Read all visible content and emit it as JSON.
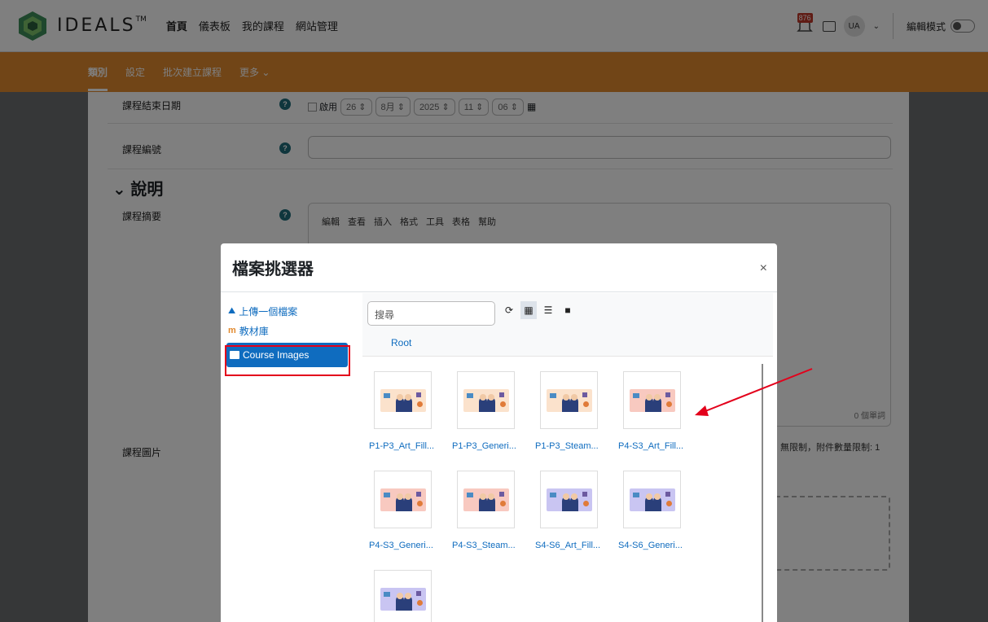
{
  "topbar": {
    "brand": "IDEALS",
    "brand_tm": "TM",
    "nav": [
      "首頁",
      "儀表板",
      "我的課程",
      "網站管理"
    ],
    "notification_count": "876",
    "user_initials": "UA",
    "edit_mode_label": "編輯模式"
  },
  "subnav": {
    "items": [
      "類別",
      "設定",
      "批次建立課程",
      "更多"
    ]
  },
  "form": {
    "end_date_label": "課程結束日期",
    "enable_label": "啟用",
    "date": {
      "day": "26",
      "month": "8月",
      "year": "2025",
      "hour": "11",
      "minute": "06"
    },
    "course_id_label": "課程編號",
    "section_title": "說明",
    "summary_label": "課程摘要",
    "editor_menu": [
      "編輯",
      "查看",
      "插入",
      "格式",
      "工具",
      "表格",
      "幫助"
    ],
    "word_count": "0 個單詞",
    "course_image_label": "課程圖片",
    "limits_text": "無限制，附件數量限制: 1"
  },
  "modal": {
    "title": "檔案挑選器",
    "close": "×",
    "sidebar": [
      {
        "label": "上傳一個檔案",
        "icon": "upload-icon"
      },
      {
        "label": "教材庫",
        "icon": "moodle-icon"
      },
      {
        "label": "Course Images",
        "icon": "folder-image-icon",
        "active": true
      }
    ],
    "search_placeholder": "搜尋",
    "breadcrumb": "Root",
    "files": [
      {
        "name": "P1-P3_Art_Fill...",
        "bg": "#fbe2cc"
      },
      {
        "name": "P1-P3_Generi...",
        "bg": "#fbe2cc"
      },
      {
        "name": "P1-P3_Steam...",
        "bg": "#fbe2cc"
      },
      {
        "name": "P4-S3_Art_Fill...",
        "bg": "#f8c9c0"
      },
      {
        "name": "P4-S3_Generi...",
        "bg": "#f8c9c0"
      },
      {
        "name": "P4-S3_Steam...",
        "bg": "#f8c9c0"
      },
      {
        "name": "S4-S6_Art_Fill...",
        "bg": "#c9c5f2"
      },
      {
        "name": "S4-S6_Generi...",
        "bg": "#c9c5f2"
      },
      {
        "name": "",
        "bg": "#c9c5f2"
      }
    ]
  },
  "colors": {
    "accent": "#0f6cbf",
    "orange": "#e28a2f",
    "highlight": "#e3001b"
  }
}
